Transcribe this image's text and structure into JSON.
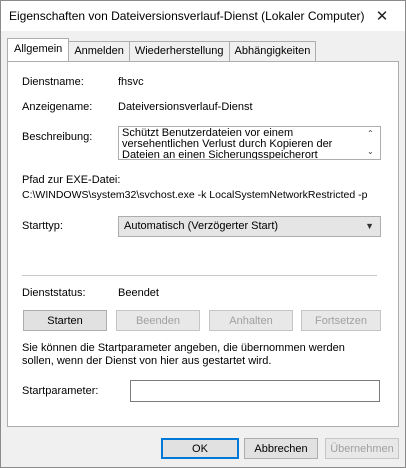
{
  "window": {
    "title": "Eigenschaften von Dateiversionsverlauf-Dienst (Lokaler Computer)",
    "close_glyph": "✕"
  },
  "tabs": [
    {
      "label": "Allgemein",
      "active": true
    },
    {
      "label": "Anmelden",
      "active": false
    },
    {
      "label": "Wiederherstellung",
      "active": false
    },
    {
      "label": "Abhängigkeiten",
      "active": false
    }
  ],
  "general": {
    "service_name_label": "Dienstname:",
    "service_name_value": "fhsvc",
    "display_name_label": "Anzeigename:",
    "display_name_value": "Dateiversionsverlauf-Dienst",
    "description_label": "Beschreibung:",
    "description_value": "Schützt Benutzerdateien vor einem versehentlichen Verlust durch Kopieren der Dateien an einen Sicherungsspeicherort",
    "path_label": "Pfad zur EXE-Datei:",
    "path_value": "C:\\WINDOWS\\system32\\svchost.exe -k LocalSystemNetworkRestricted -p",
    "startup_type_label": "Starttyp:",
    "startup_type_value": "Automatisch (Verzögerter Start)",
    "status_label": "Dienststatus:",
    "status_value": "Beendet"
  },
  "service_buttons": {
    "start": "Starten",
    "stop": "Beenden",
    "pause": "Anhalten",
    "resume": "Fortsetzen"
  },
  "start_params": {
    "hint": "Sie können die Startparameter angeben, die übernommen werden sollen, wenn der Dienst von hier aus gestartet wird.",
    "label": "Startparameter:",
    "value": ""
  },
  "dialog_buttons": {
    "ok": "OK",
    "cancel": "Abbrechen",
    "apply": "Übernehmen"
  }
}
